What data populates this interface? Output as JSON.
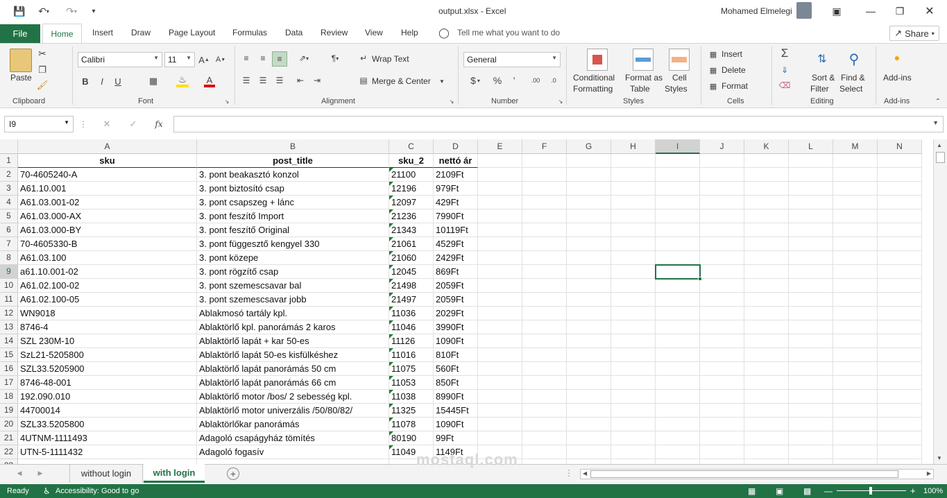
{
  "window": {
    "title": "output.xlsx  -  Excel",
    "user": "Mohamed Elmelegi"
  },
  "tabs": {
    "file": "File",
    "items": [
      "Home",
      "Insert",
      "Draw",
      "Page Layout",
      "Formulas",
      "Data",
      "Review",
      "View",
      "Help"
    ],
    "tellme": "Tell me what you want to do",
    "share": "Share"
  },
  "ribbon": {
    "clipboard": {
      "label": "Clipboard",
      "paste": "Paste"
    },
    "font": {
      "label": "Font",
      "name": "Calibri",
      "size": "11",
      "bold": "B",
      "italic": "I",
      "underline": "U"
    },
    "alignment": {
      "label": "Alignment",
      "wrap": "Wrap Text",
      "merge": "Merge & Center"
    },
    "number": {
      "label": "Number",
      "format": "General",
      "currency": "$",
      "percent": "%",
      "comma": "’",
      "inc": ".00",
      "dec": ".0"
    },
    "styles": {
      "label": "Styles",
      "cond1": "Conditional",
      "cond2": "Formatting",
      "table1": "Format as",
      "table2": "Table",
      "cell1": "Cell",
      "cell2": "Styles"
    },
    "cells": {
      "label": "Cells",
      "insert": "Insert",
      "delete": "Delete",
      "format": "Format"
    },
    "editing": {
      "label": "Editing",
      "sort1": "Sort &",
      "sort2": "Filter",
      "find1": "Find &",
      "find2": "Select"
    },
    "addins": {
      "label": "Add-ins",
      "btn": "Add-ins"
    }
  },
  "formula_bar": {
    "namebox": "I9",
    "fx": "fx",
    "cancel": "✕",
    "enter": "✓"
  },
  "grid": {
    "columns": [
      "A",
      "B",
      "C",
      "D",
      "E",
      "F",
      "G",
      "H",
      "I",
      "J",
      "K",
      "L",
      "M",
      "N"
    ],
    "header": [
      "sku",
      "post_title",
      "sku_2",
      "nettó ár"
    ],
    "rows": [
      [
        "70-4605240-A",
        "3. pont beakasztó konzol",
        "21100",
        "2109Ft"
      ],
      [
        "A61.10.001",
        "3. pont biztosító csap",
        "12196",
        "979Ft"
      ],
      [
        "A61.03.001-02",
        "3. pont csapszeg + lánc",
        "12097",
        "429Ft"
      ],
      [
        "A61.03.000-AX",
        "3. pont feszítő Import",
        "21236",
        "7990Ft"
      ],
      [
        "A61.03.000-BY",
        "3. pont feszítő Original",
        "21343",
        "10119Ft"
      ],
      [
        "70-4605330-B",
        "3. pont függesztő kengyel 330",
        "21061",
        "4529Ft"
      ],
      [
        "A61.03.100",
        "3. pont közepe",
        "21060",
        "2429Ft"
      ],
      [
        "a61.10.001-02",
        "3. pont rögzítő csap",
        "12045",
        "869Ft"
      ],
      [
        "A61.02.100-02",
        "3. pont szemescsavar bal",
        "21498",
        "2059Ft"
      ],
      [
        "A61.02.100-05",
        "3. pont szemescsavar jobb",
        "21497",
        "2059Ft"
      ],
      [
        "WN9018",
        "Ablakmosó tartály kpl.",
        "11036",
        "2029Ft"
      ],
      [
        "8746-4",
        "Ablaktörlő kpl. panorámás 2 karos",
        "11046",
        "3990Ft"
      ],
      [
        "SZL 230M-10",
        "Ablaktörlő lapát + kar 50-es",
        "11126",
        "1090Ft"
      ],
      [
        "SzL21-5205800",
        "Ablaktörlő lapát 50-es kisfülkéshez",
        "11016",
        "810Ft"
      ],
      [
        "SZL33.5205900",
        "Ablaktörlő lapát panorámás 50 cm",
        "11075",
        "560Ft"
      ],
      [
        "8746-48-001",
        "Ablaktörlő lapát panorámás 66 cm",
        "11053",
        "850Ft"
      ],
      [
        "192.090.010",
        "Ablaktörlő motor /bos/ 2 sebesség kpl.",
        "11038",
        "8990Ft"
      ],
      [
        "44700014",
        "Ablaktörlő motor univerzális /50/80/82/",
        "11325",
        "15445Ft"
      ],
      [
        "SZL33.5205800",
        "Ablaktörlőkar panorámás",
        "11078",
        "1090Ft"
      ],
      [
        "4UTNM-1111493",
        "Adagoló csapágyház tömítés",
        "80190",
        "99Ft"
      ],
      [
        "UTN-5-1111432",
        "Adagoló fogasív",
        "11049",
        "1149Ft"
      ]
    ]
  },
  "sheets": [
    "without login",
    "with login"
  ],
  "status": {
    "ready": "Ready",
    "accessibility": "Accessibility: Good to go",
    "zoom": "100%"
  },
  "watermark": "mostaql.com",
  "colors": {
    "excel_green": "#217346"
  }
}
